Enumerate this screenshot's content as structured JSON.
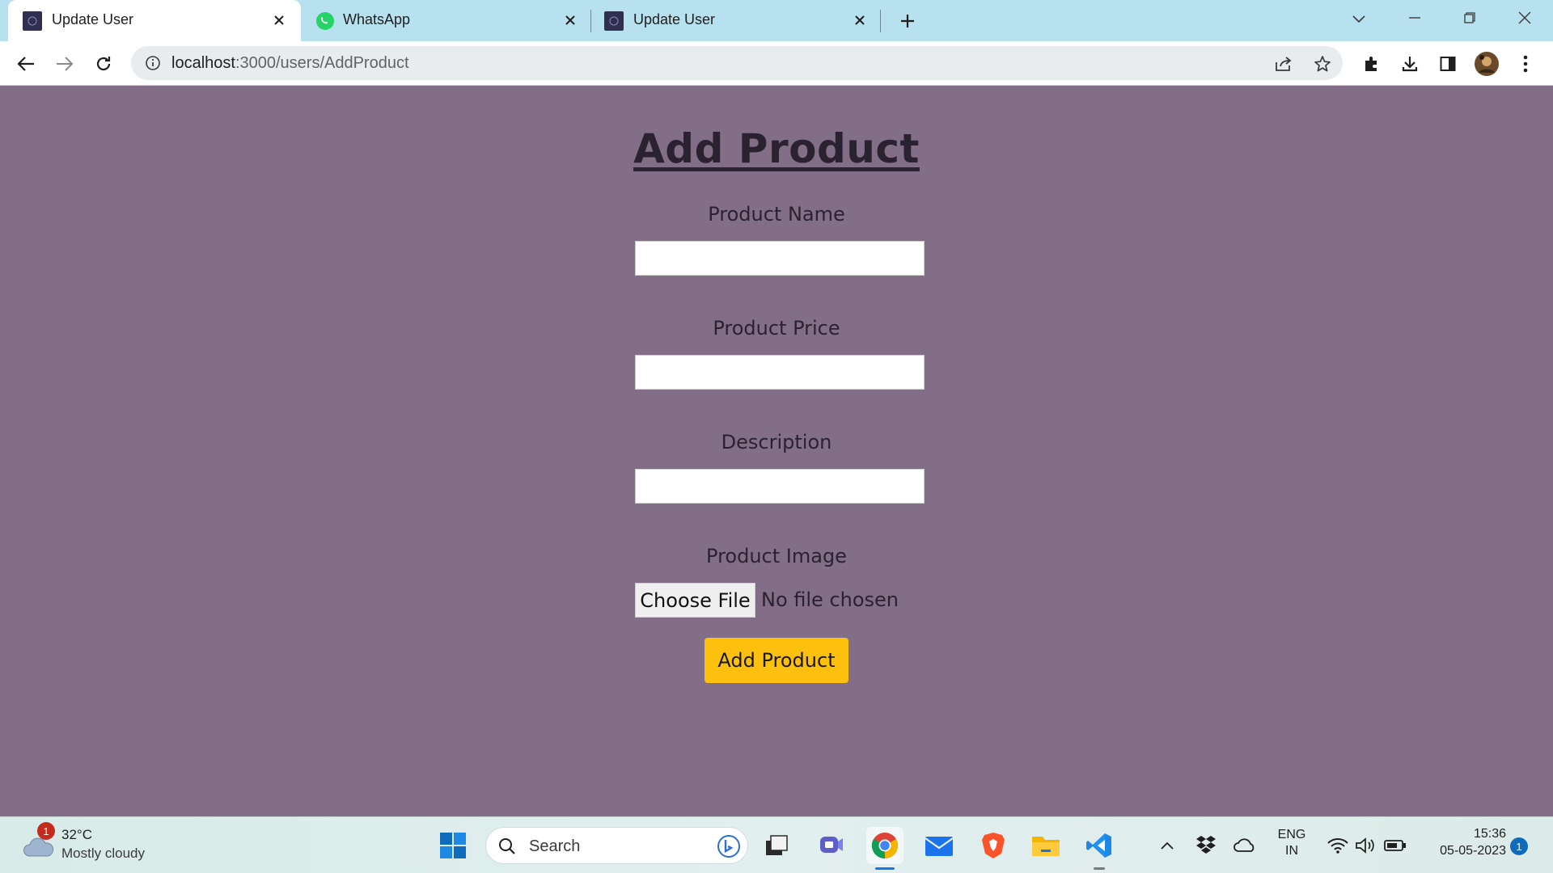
{
  "browser": {
    "tabs": [
      {
        "title": "Update User",
        "active": true
      },
      {
        "title": "WhatsApp",
        "active": false
      },
      {
        "title": "Update User",
        "active": false
      }
    ],
    "url_host": "localhost",
    "url_path": ":3000/users/AddProduct"
  },
  "page": {
    "heading": "Add Product",
    "fields": {
      "name_label": "Product Name",
      "name_value": "",
      "price_label": "Product Price",
      "price_value": "",
      "description_label": "Description",
      "description_value": "",
      "image_label": "Product Image",
      "file_button": "Choose File",
      "file_status": "No file chosen"
    },
    "submit_label": "Add Product",
    "colors": {
      "background": "#826E87",
      "submit": "#FEC00F"
    }
  },
  "taskbar": {
    "weather": {
      "temp": "32°C",
      "desc": "Mostly cloudy",
      "badge": "1"
    },
    "search_label": "Search",
    "apps": [
      "windows-start",
      "search",
      "task-view",
      "teams-chat",
      "chrome",
      "mail",
      "brave",
      "file-explorer",
      "vscode"
    ],
    "tray": {
      "lang_top": "ENG",
      "lang_bottom": "IN",
      "time": "15:36",
      "date": "05-05-2023",
      "notifications": "1"
    }
  }
}
